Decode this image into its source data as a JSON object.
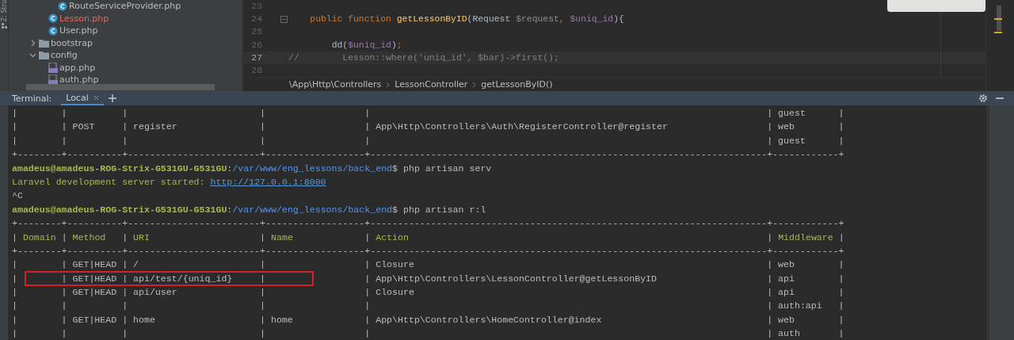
{
  "side_strip": {
    "label": "Z: Stru"
  },
  "project_tree": {
    "items": [
      {
        "kind": "group",
        "children": [
          {
            "kind": "group",
            "children": [
              {
                "kind": "class",
                "label": "RouteServiceProvider.php",
                "unversioned": false
              }
            ]
          },
          {
            "kind": "class",
            "label": "Lesson.php",
            "unversioned": true
          },
          {
            "kind": "class",
            "label": "User.php",
            "unversioned": false
          }
        ]
      },
      {
        "kind": "folder",
        "label": "bootstrap",
        "expanded": false
      },
      {
        "kind": "folder",
        "label": "config",
        "expanded": true,
        "children": [
          {
            "kind": "php",
            "label": "app.php",
            "unversioned": false
          },
          {
            "kind": "php",
            "label": "auth.php",
            "unversioned": false
          }
        ]
      }
    ]
  },
  "editor": {
    "lines": [
      {
        "number": "23",
        "current": false,
        "foldable": false
      },
      {
        "number": "24",
        "current": false,
        "foldable": true,
        "tokens": [
          {
            "kind": "keyword",
            "text": "    public function "
          },
          {
            "kind": "function",
            "text": "getLessonByID"
          },
          {
            "kind": "plain",
            "text": "(Request "
          },
          {
            "kind": "unused",
            "text": "$request"
          },
          {
            "kind": "keyword",
            "text": ","
          },
          {
            "kind": "variable",
            "text": " $uniq_id"
          },
          {
            "kind": "plain",
            "text": "){"
          }
        ]
      },
      {
        "number": "25",
        "current": false,
        "foldable": false
      },
      {
        "number": "26",
        "current": false,
        "foldable": false,
        "tokens": [
          {
            "kind": "plain",
            "text": "        dd("
          },
          {
            "kind": "variable",
            "text": "$uniq_id"
          },
          {
            "kind": "plain",
            "text": ")"
          },
          {
            "kind": "keyword",
            "text": ";"
          }
        ]
      },
      {
        "number": "27",
        "current": true,
        "foldable": false,
        "tokens": [
          {
            "kind": "comment",
            "text": "//        Lesson::where('uniq_id', $bar)->first();"
          }
        ]
      },
      {
        "number": "28",
        "current": false,
        "foldable": false
      }
    ],
    "breadcrumbs": [
      "\\App\\Http\\Controllers",
      "LessonController",
      "getLessonByID()"
    ]
  },
  "terminal": {
    "title": "Terminal:",
    "tabs": [
      {
        "label": "Local",
        "selected": true
      }
    ],
    "lines": [
      {
        "highlighted": false,
        "segments": [
          {
            "kind": "plain",
            "text": "|        |          |                        |                  |                                                                        | guest      |"
          }
        ]
      },
      {
        "highlighted": false,
        "segments": [
          {
            "kind": "plain",
            "text": "|        | POST     | register               |                  | App\\Http\\Controllers\\Auth\\RegisterController@register                  | web        |"
          }
        ]
      },
      {
        "highlighted": false,
        "segments": [
          {
            "kind": "plain",
            "text": "|        |          |                        |                  |                                                                        | guest      |"
          }
        ]
      },
      {
        "highlighted": false,
        "segments": [
          {
            "kind": "plain",
            "text": "+--------+----------+------------------------+------------------+------------------------------------------------------------------------+------------+"
          }
        ]
      },
      {
        "highlighted": false,
        "segments": [
          {
            "kind": "user",
            "text": "amadeus@amadeus-ROG-Strix-G531GU-G531GU"
          },
          {
            "kind": "plain",
            "text": ":"
          },
          {
            "kind": "path",
            "text": "/var/www/eng_lessons/back_end"
          },
          {
            "kind": "plain",
            "text": "$ php artisan serv"
          }
        ]
      },
      {
        "highlighted": false,
        "segments": [
          {
            "kind": "info",
            "text": "Laravel development server started: "
          },
          {
            "kind": "link",
            "text": "http://127.0.0.1:8000"
          }
        ]
      },
      {
        "highlighted": false,
        "segments": [
          {
            "kind": "plain",
            "text": "^C"
          }
        ]
      },
      {
        "highlighted": false,
        "segments": [
          {
            "kind": "user",
            "text": "amadeus@amadeus-ROG-Strix-G531GU-G531GU"
          },
          {
            "kind": "plain",
            "text": ":"
          },
          {
            "kind": "path",
            "text": "/var/www/eng_lessons/back_end"
          },
          {
            "kind": "plain",
            "text": "$ php artisan r:l"
          }
        ]
      },
      {
        "highlighted": false,
        "segments": [
          {
            "kind": "plain",
            "text": "+--------+----------+------------------------+------------------+------------------------------------------------------------------------+------------+"
          }
        ]
      },
      {
        "highlighted": false,
        "segments": [
          {
            "kind": "border",
            "text": "| "
          },
          {
            "kind": "head",
            "text": "Domain"
          },
          {
            "kind": "border",
            "text": " | "
          },
          {
            "kind": "head",
            "text": "Method"
          },
          {
            "kind": "border",
            "text": "   | "
          },
          {
            "kind": "head",
            "text": "URI"
          },
          {
            "kind": "border",
            "text": "                    | "
          },
          {
            "kind": "head",
            "text": "Name"
          },
          {
            "kind": "border",
            "text": "             | "
          },
          {
            "kind": "head",
            "text": "Action"
          },
          {
            "kind": "border",
            "text": "                                                                 | "
          },
          {
            "kind": "head",
            "text": "Middleware"
          },
          {
            "kind": "border",
            "text": " |"
          }
        ]
      },
      {
        "highlighted": false,
        "segments": [
          {
            "kind": "plain",
            "text": "+--------+----------+------------------------+------------------+------------------------------------------------------------------------+------------+"
          }
        ]
      },
      {
        "highlighted": false,
        "segments": [
          {
            "kind": "plain",
            "text": "|        | GET|HEAD | /                      |                  | Closure                                                                | web        |"
          }
        ]
      },
      {
        "highlighted": true,
        "segments": [
          {
            "kind": "plain",
            "text": "|        | GET|HEAD | api/test/{uniq_id}     |                  | App\\Http\\Controllers\\LessonController@getLessonByID                    | api        |"
          }
        ]
      },
      {
        "highlighted": false,
        "segments": [
          {
            "kind": "plain",
            "text": "|        | GET|HEAD | api/user               |                  | Closure                                                                | api        |"
          }
        ]
      },
      {
        "highlighted": false,
        "segments": [
          {
            "kind": "plain",
            "text": "|        |          |                        |                  |                                                                        | auth:api   |"
          }
        ]
      },
      {
        "highlighted": false,
        "segments": [
          {
            "kind": "plain",
            "text": "|        | GET|HEAD | home                   | home             | App\\Http\\Controllers\\HomeController@index                              | web        |"
          }
        ]
      },
      {
        "highlighted": false,
        "segments": [
          {
            "kind": "plain",
            "text": "|        |          |                        |                  |                                                                        | auth       |"
          }
        ]
      }
    ]
  }
}
